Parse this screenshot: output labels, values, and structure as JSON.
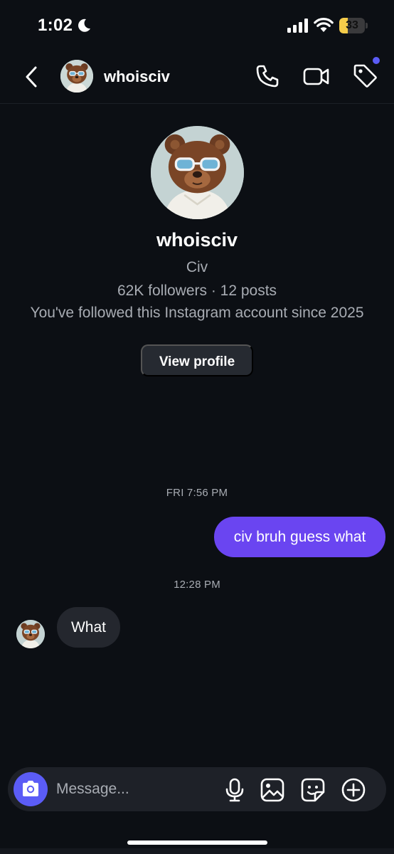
{
  "status_bar": {
    "time": "1:02",
    "battery_level": "33",
    "battery_fraction": 0.33,
    "icons": [
      "moon-icon",
      "signal-icon",
      "wifi-icon",
      "battery-icon"
    ]
  },
  "header": {
    "username": "whoisciv",
    "icons": [
      "chevron-left-icon",
      "phone-icon",
      "video-camera-icon",
      "tag-icon"
    ],
    "notification_dot_color": "#5b5cf6"
  },
  "profile": {
    "username": "whoisciv",
    "full_name": "Civ",
    "stats": "62K followers · 12 posts",
    "follow_note": "You've followed this Instagram account since 2025",
    "view_profile_label": "View profile"
  },
  "messages": [
    {
      "type": "timestamp",
      "text": "FRI 7:56 PM"
    },
    {
      "type": "outgoing",
      "text": "civ bruh guess what"
    },
    {
      "type": "timestamp",
      "text": "12:28 PM"
    },
    {
      "type": "incoming",
      "text": "What"
    }
  ],
  "composer": {
    "placeholder": "Message...",
    "icons": [
      "camera-icon",
      "microphone-icon",
      "image-icon",
      "sticker-icon",
      "plus-circle-icon"
    ]
  },
  "colors": {
    "background": "#0c0f14",
    "accent": "#5b5cf6",
    "outgoing_bubble": "#6a45f1",
    "incoming_bubble": "#24272e",
    "secondary_text": "#a8acb3"
  }
}
